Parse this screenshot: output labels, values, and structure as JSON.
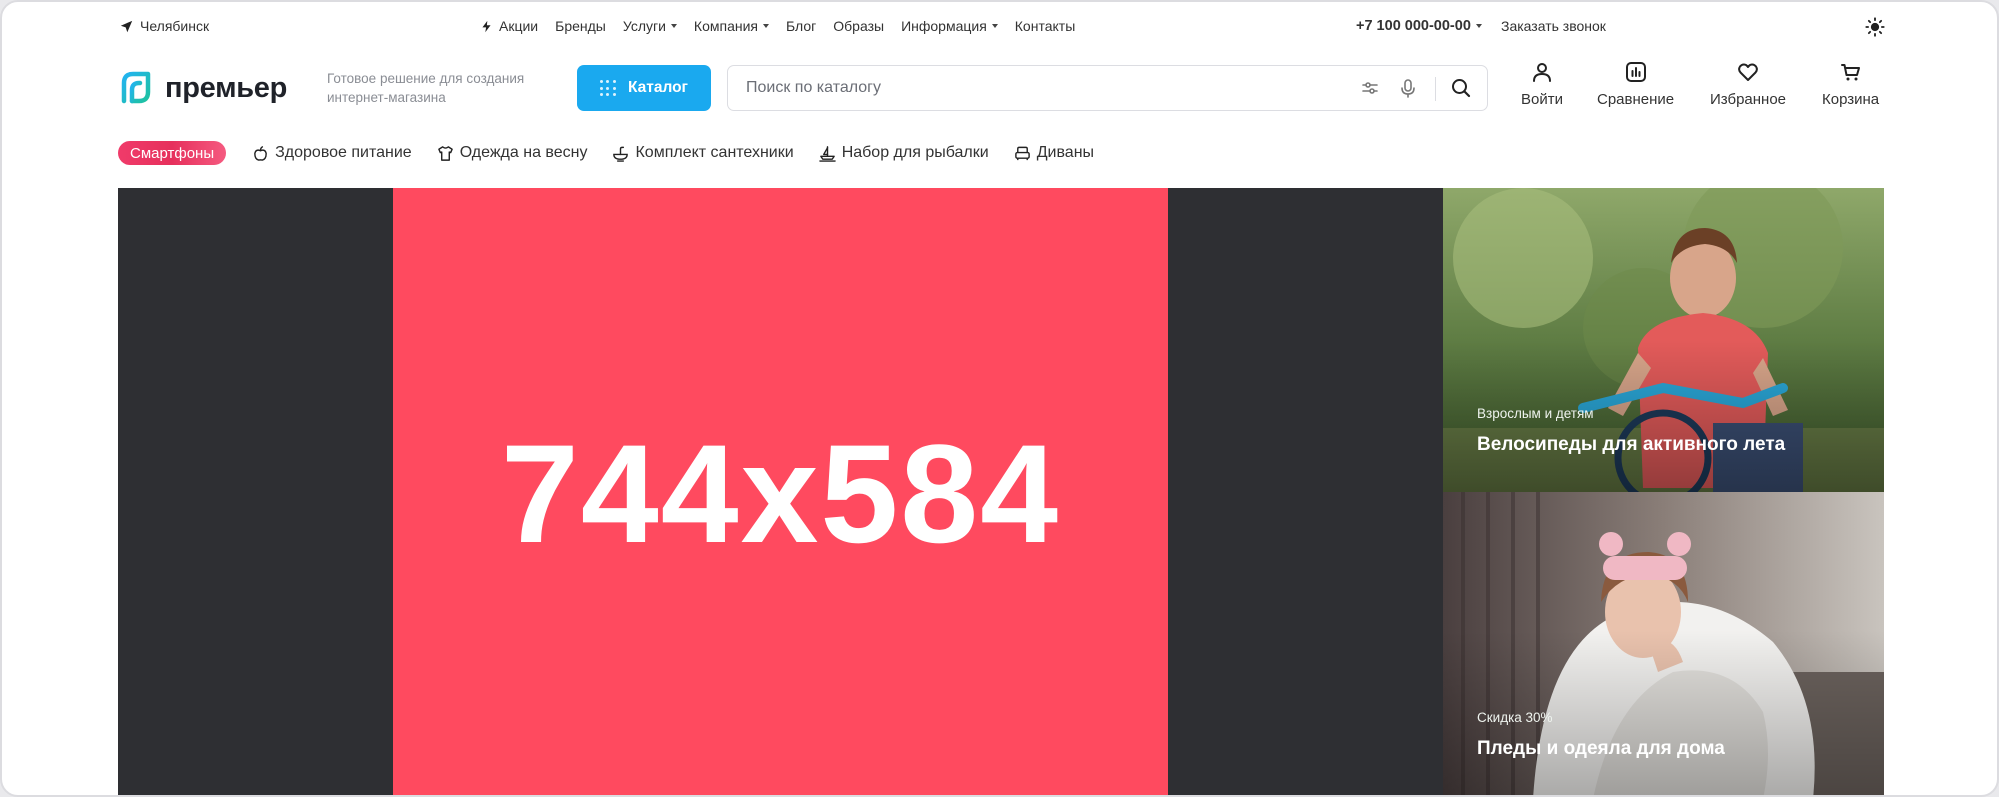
{
  "topbar": {
    "city": "Челябинск",
    "nav": [
      {
        "label": "Акции",
        "icon": "lightning-icon",
        "dropdown": false
      },
      {
        "label": "Бренды",
        "dropdown": false
      },
      {
        "label": "Услуги",
        "dropdown": true
      },
      {
        "label": "Компания",
        "dropdown": true
      },
      {
        "label": "Блог",
        "dropdown": false
      },
      {
        "label": "Образы",
        "dropdown": false
      },
      {
        "label": "Информация",
        "dropdown": true
      },
      {
        "label": "Контакты",
        "dropdown": false
      }
    ],
    "phone": "+7 100 000-00-00",
    "callback": "Заказать звонок",
    "theme_icon": "sun-icon"
  },
  "header": {
    "logo_text": "премьер",
    "tagline": "Готовое решение для создания интернет-магазина",
    "catalog_label": "Каталог",
    "search_placeholder": "Поиск по каталогу",
    "actions": [
      {
        "label": "Войти",
        "icon": "user-icon"
      },
      {
        "label": "Сравнение",
        "icon": "chart-icon"
      },
      {
        "label": "Избранное",
        "icon": "heart-icon"
      },
      {
        "label": "Корзина",
        "icon": "cart-icon"
      }
    ]
  },
  "quick_links": {
    "highlight": "Смартфоны",
    "items": [
      {
        "label": "Здоровое питание",
        "icon": "apple-icon"
      },
      {
        "label": "Одежда на весну",
        "icon": "tshirt-icon"
      },
      {
        "label": "Комплект сантехники",
        "icon": "sink-icon"
      },
      {
        "label": "Набор для рыбалки",
        "icon": "boat-icon"
      },
      {
        "label": "Диваны",
        "icon": "sofa-icon"
      }
    ]
  },
  "hero": {
    "label": "744x584"
  },
  "promos": [
    {
      "subtitle": "Взрослым и детям",
      "title": "Велосипеды для активного лета"
    },
    {
      "subtitle": "Скидка 30%",
      "title": "Пледы и одеяла для дома"
    }
  ],
  "colors": {
    "accent": "#1aa9ef",
    "hero": "#ff4a5f",
    "hero_bg": "#2e2f33",
    "chip": "#e6305c"
  }
}
